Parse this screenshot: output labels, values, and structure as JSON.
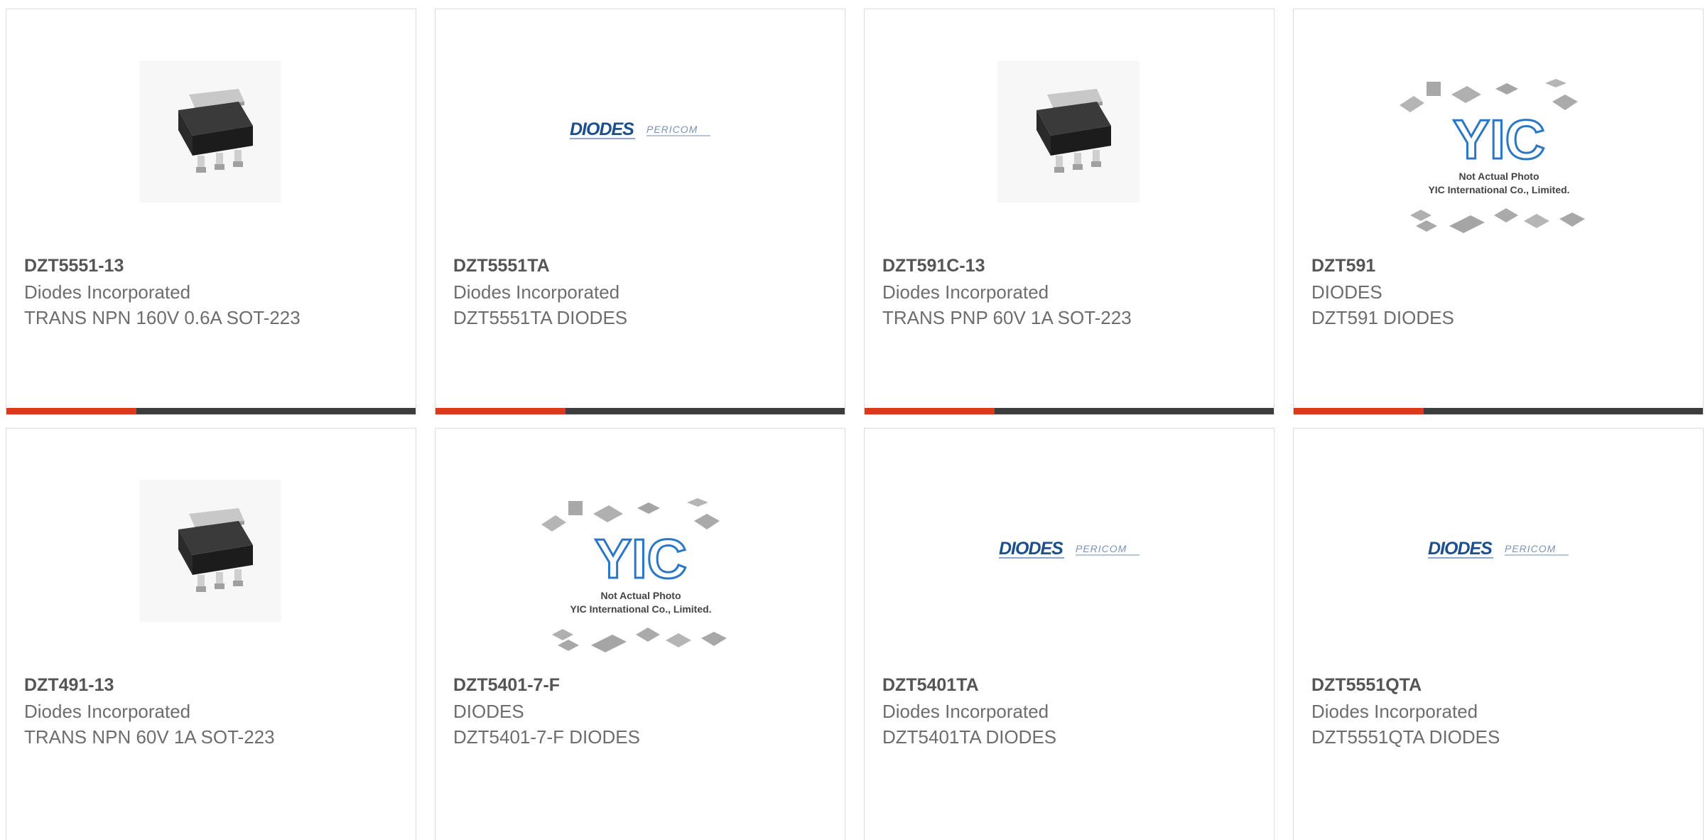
{
  "products": [
    {
      "part_number": "DZT5551-13",
      "manufacturer": "Diodes Incorporated",
      "description": "TRANS NPN 160V 0.6A SOT-223",
      "image": "sot223-package"
    },
    {
      "part_number": "DZT5551TA",
      "manufacturer": "Diodes Incorporated",
      "description": "DZT5551TA DIODES",
      "image": "diodes-pericom-logo"
    },
    {
      "part_number": "DZT591C-13",
      "manufacturer": "Diodes Incorporated",
      "description": "TRANS PNP 60V 1A SOT-223",
      "image": "sot223-package"
    },
    {
      "part_number": "DZT591",
      "manufacturer": "DIODES",
      "description": "DZT591 DIODES",
      "image": "yic-not-actual-photo"
    },
    {
      "part_number": "DZT491-13",
      "manufacturer": "Diodes Incorporated",
      "description": "TRANS NPN 60V 1A SOT-223",
      "image": "sot223-package"
    },
    {
      "part_number": "DZT5401-7-F",
      "manufacturer": "DIODES",
      "description": "DZT5401-7-F DIODES",
      "image": "yic-not-actual-photo"
    },
    {
      "part_number": "DZT5401TA",
      "manufacturer": "Diodes Incorporated",
      "description": "DZT5401TA DIODES",
      "image": "diodes-pericom-logo"
    },
    {
      "part_number": "DZT5551QTA",
      "manufacturer": "Diodes Incorporated",
      "description": "DZT5551QTA DIODES",
      "image": "diodes-pericom-logo"
    }
  ],
  "logo": {
    "brand": "DIODES",
    "partner": "PERICOM"
  },
  "placeholder": {
    "brand": "YIC",
    "line1": "Not Actual Photo",
    "line2": "YIC International Co., Limited."
  },
  "colors": {
    "accent": "#e0361c",
    "bar": "#3d3d3d",
    "text_bold": "#555555",
    "text": "#6d6d6d",
    "logo_blue": "#1d4f8c"
  }
}
